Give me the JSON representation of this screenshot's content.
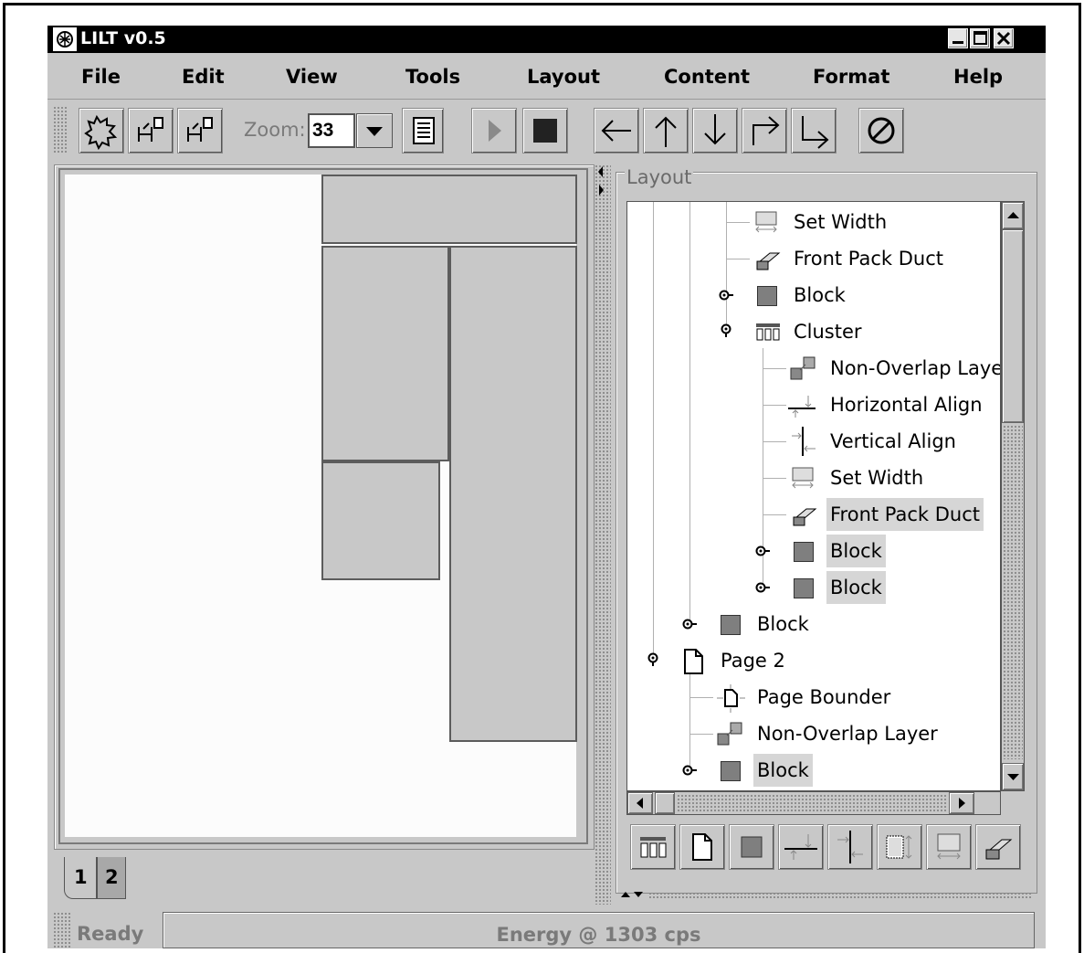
{
  "window": {
    "title": "LILT v0.5"
  },
  "menubar": {
    "items": [
      "File",
      "Edit",
      "View",
      "Tools",
      "Layout",
      "Content",
      "Format",
      "Help"
    ]
  },
  "toolbar": {
    "zoom_label": "Zoom:",
    "zoom_value": "33"
  },
  "page_tabs": [
    "1",
    "2"
  ],
  "layout_panel": {
    "title": "Layout",
    "tree": [
      {
        "label": "Set Width",
        "icon": "set-width-icon",
        "depth": 3,
        "selected": false
      },
      {
        "label": "Front Pack Duct",
        "icon": "front-pack-duct-icon",
        "depth": 3,
        "selected": false
      },
      {
        "label": "Block",
        "icon": "block-icon",
        "depth": 3,
        "toggle": "collapsed",
        "selected": false
      },
      {
        "label": "Cluster",
        "icon": "cluster-icon",
        "depth": 3,
        "toggle": "expanded",
        "selected": false
      },
      {
        "label": "Non-Overlap Layer",
        "icon": "non-overlap-layer-icon",
        "depth": 4,
        "selected": false
      },
      {
        "label": "Horizontal Align",
        "icon": "horizontal-align-icon",
        "depth": 4,
        "selected": false
      },
      {
        "label": "Vertical Align",
        "icon": "vertical-align-icon",
        "depth": 4,
        "selected": false
      },
      {
        "label": "Set Width",
        "icon": "set-width-icon",
        "depth": 4,
        "selected": false
      },
      {
        "label": "Front Pack Duct",
        "icon": "front-pack-duct-icon",
        "depth": 4,
        "selected": true
      },
      {
        "label": "Block",
        "icon": "block-icon",
        "depth": 4,
        "toggle": "collapsed",
        "selected": true
      },
      {
        "label": "Block",
        "icon": "block-icon",
        "depth": 4,
        "toggle": "collapsed",
        "selected": true
      },
      {
        "label": "Block",
        "icon": "block-icon",
        "depth": 2,
        "toggle": "collapsed",
        "selected": false
      },
      {
        "label": "Page 2",
        "icon": "page-icon",
        "depth": 1,
        "toggle": "expanded",
        "selected": false
      },
      {
        "label": "Page Bounder",
        "icon": "page-bounder-icon",
        "depth": 2,
        "selected": false
      },
      {
        "label": "Non-Overlap Layer",
        "icon": "non-overlap-layer-icon",
        "depth": 2,
        "selected": false
      },
      {
        "label": "Block",
        "icon": "block-icon",
        "depth": 2,
        "toggle": "collapsed",
        "selected": true
      }
    ]
  },
  "status": {
    "state": "Ready",
    "message": "Energy @ 1303 cps"
  },
  "colors": {
    "chrome": "#c8c8c8",
    "titlebar": "#000000",
    "canvas": "#fcfcfc",
    "block_fill": "#c8c8c8",
    "block_icon": "#7f7f7f",
    "selection": "#d6d6d6"
  }
}
